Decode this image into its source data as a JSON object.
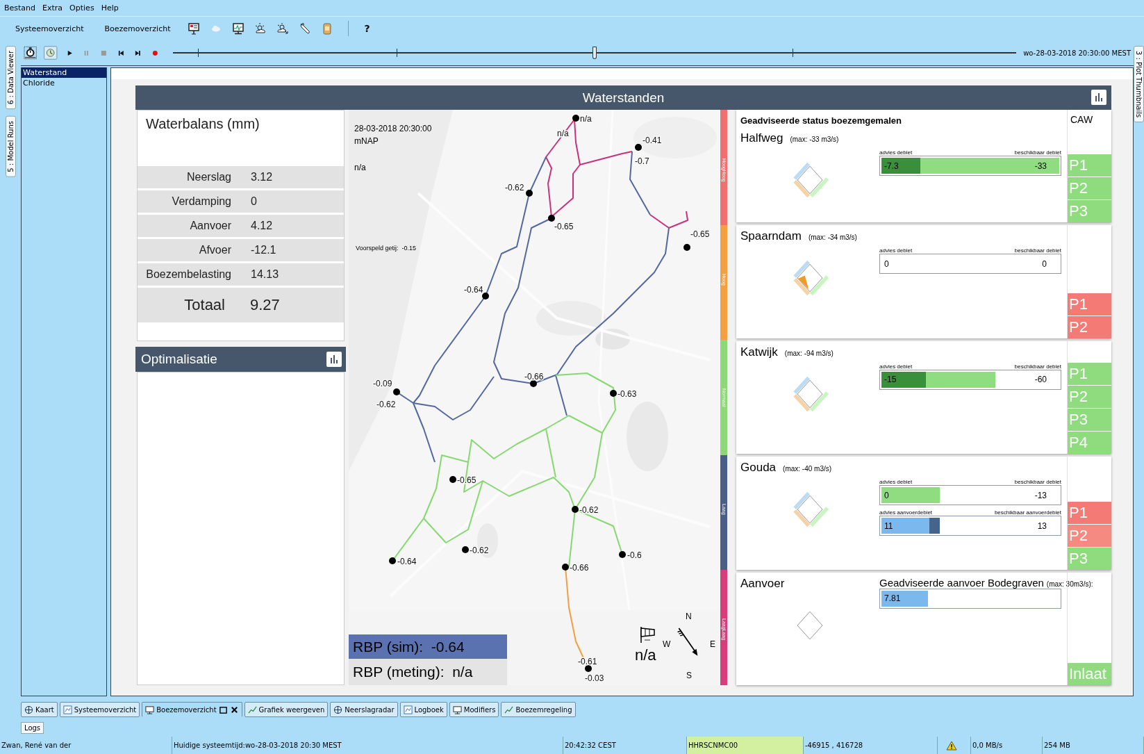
{
  "menu": [
    "Bestand",
    "Extra",
    "Opties",
    "Help"
  ],
  "toolbar": {
    "buttons": [
      "Systeemoverzicht",
      "Boezemoverzicht"
    ],
    "help": "?"
  },
  "time": {
    "level": 0.5,
    "datetime": "wo-28-03-2018 20:30:00 MEST"
  },
  "side_tabs": [
    "6 : Data Viewer",
    "5 : Model Runs"
  ],
  "right_tabs": [
    "3 : Plot Thumbnails"
  ],
  "parameters": [
    {
      "label": "Waterstand",
      "selected": true
    },
    {
      "label": "Chloride",
      "selected": false
    }
  ],
  "dashboard": {
    "title": "Waterstanden",
    "waterbalans": {
      "title": "Waterbalans (mm)",
      "rows": [
        {
          "label": "Neerslag",
          "value": "3.12"
        },
        {
          "label": "Verdamping",
          "value": "0"
        },
        {
          "label": "Aanvoer",
          "value": "4.12"
        },
        {
          "label": "Afvoer",
          "value": "-12.1"
        },
        {
          "label": "Boezembelasting",
          "value": "14.13"
        }
      ],
      "total": {
        "label": "Totaal",
        "value": "9.27"
      }
    },
    "optimalisatie": {
      "title": "Optimalisatie"
    },
    "map": {
      "datetime": "28-03-2018 20:30:00",
      "unit": "mNAP",
      "value": "n/a",
      "tide": "Voorspeld getij:  -0.15",
      "level_labels": [
        "n/a",
        "n/a",
        "-0.41",
        "-0.7",
        "-0.62",
        "-0.65",
        "-0.65",
        "-0.64",
        "-0.66",
        "-0.63",
        "-0.09",
        "-0.62",
        "-0.65",
        "-0.62",
        "-0.62",
        "-0.64",
        "-0.6",
        "-0.66",
        "-0.61",
        "-0.03"
      ],
      "legend": [
        {
          "label": "HoogHoog",
          "color": "#f07070"
        },
        {
          "label": "Hoog",
          "color": "#f5a040"
        },
        {
          "label": "Normaal",
          "color": "#8ed87a"
        },
        {
          "label": "Laag",
          "color": "#4a5f86"
        },
        {
          "label": "LaagLaag",
          "color": "#d63d7a"
        }
      ],
      "rbp_sim": "RBP (sim):  -0.64",
      "rbp_meting": "RBP (meting):  n/a",
      "wind": "n/a",
      "compass": [
        "N",
        "W",
        "E",
        "S"
      ]
    },
    "stations": {
      "title": "Geadviseerde status boezemgemalen",
      "caw_title": "CAW",
      "items": [
        {
          "kind": "gemaal",
          "name": "Halfweg",
          "max": "(max: -33 m3/s)",
          "alert": false,
          "bars": [
            {
              "kind": "afvoer",
              "advice": {
                "label": "advies debiet",
                "value": "-7.3",
                "level": 0.22
              },
              "available": {
                "label": "beschikbaar debiet",
                "value": "-33",
                "level": 1
              }
            }
          ],
          "pumps": [
            {
              "label": "P1",
              "color": "#8fdc7f"
            },
            {
              "label": "P2",
              "color": "#8fdc7f"
            },
            {
              "label": "P3",
              "color": "#8fdc7f"
            }
          ]
        },
        {
          "kind": "gemaal",
          "name": "Spaarndam",
          "max": "(max: -34 m3/s)",
          "alert": true,
          "bars": [
            {
              "kind": "afvoer",
              "advice": {
                "label": "advies debiet",
                "value": "0"
              },
              "available": {
                "label": "beschikbaar debiet",
                "value": "0"
              }
            }
          ],
          "pumps": [
            {
              "label": "P1",
              "color": "#f47a75"
            },
            {
              "label": "P2",
              "color": "#f47a75"
            }
          ]
        },
        {
          "kind": "gemaal",
          "name": "Katwijk",
          "max": "(max: -94 m3/s)",
          "alert": false,
          "bars": [
            {
              "kind": "afvoer",
              "advice": {
                "label": "advies debiet",
                "value": "-15",
                "level": 0.25
              },
              "available": {
                "label": "beschikbaar debiet",
                "value": "-60",
                "level": 0.64
              }
            }
          ],
          "pumps": [
            {
              "label": "P1",
              "color": "#8fdc7f"
            },
            {
              "label": "P2",
              "color": "#8fdc7f"
            },
            {
              "label": "P3",
              "color": "#8fdc7f"
            },
            {
              "label": "P4",
              "color": "#8fdc7f"
            }
          ]
        },
        {
          "kind": "gemaal",
          "name": "Gouda",
          "max": "(max: -40 m3/s)",
          "alert": false,
          "bars": [
            {
              "kind": "afvoer",
              "advice": {
                "label": "advies debiet",
                "value": "0"
              },
              "available": {
                "label": "beschikbaar debiet",
                "value": "-13",
                "level": 0.33
              }
            },
            {
              "kind": "aanvoer",
              "advice": {
                "label": "advies aanvoerdebiet",
                "value": "11",
                "level": 0.27
              },
              "available": {
                "label": "beschikbaar aanvoerdebiet",
                "value": "13",
                "level": 0.33
              }
            }
          ],
          "pumps": [
            {
              "label": "P1",
              "color": "#f47a75"
            },
            {
              "label": "P2",
              "color": "#f48a80"
            },
            {
              "label": "P3",
              "color": "#8fdc7f"
            }
          ]
        },
        {
          "kind": "inlaat",
          "name": "Aanvoer",
          "heading": "Geadviseerde aanvoer  Bodegraven",
          "max": "(max: 30m3/s):",
          "alert": false,
          "bars": [
            {
              "kind": "aanvoer",
              "advice": {
                "value": "7.81",
                "level": 0.26
              }
            }
          ],
          "pumps": [
            {
              "label": "Inlaat",
              "color": "#8fdc7f"
            }
          ]
        }
      ]
    }
  },
  "bottom_tabs": [
    {
      "label": "Kaart",
      "selected": false
    },
    {
      "label": "Systeemoverzicht",
      "selected": false
    },
    {
      "label": "Boezemoverzicht",
      "selected": true
    },
    {
      "label": "Grafiek weergeven",
      "selected": false
    },
    {
      "label": "Neerslagradar",
      "selected": false
    },
    {
      "label": "Logboek",
      "selected": false
    },
    {
      "label": "Modifiers",
      "selected": false
    },
    {
      "label": "Boezemregeling",
      "selected": false
    }
  ],
  "logs": "Logs",
  "status_bar": [
    {
      "kind": "text",
      "text": "Zwan, René van der"
    },
    {
      "kind": "text",
      "text": "Huidige systeemtijd:wo-28-03-2018 20:30 MEST"
    },
    {
      "kind": "text",
      "text": "20:42:32 CEST"
    },
    {
      "kind": "highlight",
      "text": "HHRSCNMC00"
    },
    {
      "kind": "text",
      "text": "-46915 , 416728"
    },
    {
      "kind": "warning"
    },
    {
      "kind": "text",
      "text": "0,0 MB/s"
    },
    {
      "kind": "text",
      "text": "254 MB"
    }
  ]
}
